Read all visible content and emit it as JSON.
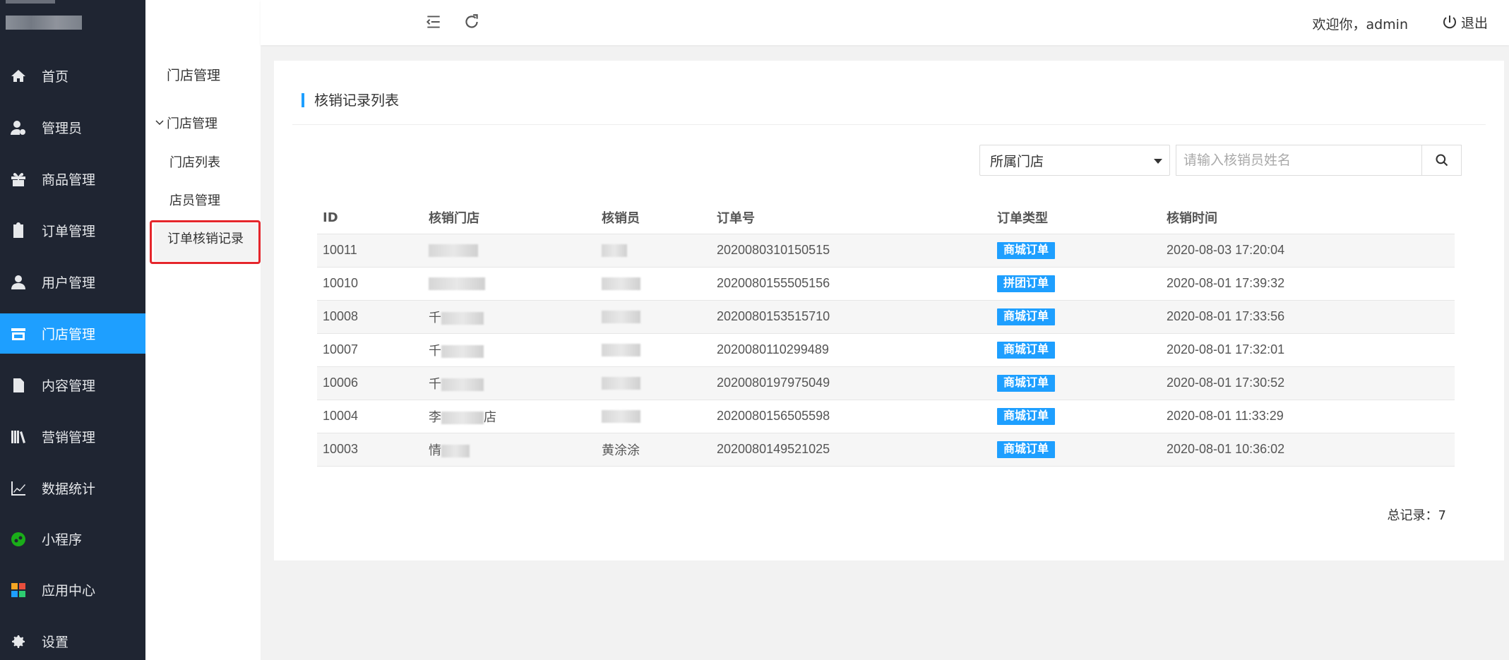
{
  "sidebar": {
    "items": [
      {
        "label": "首页",
        "icon": "home-icon"
      },
      {
        "label": "管理员",
        "icon": "admin-user-icon"
      },
      {
        "label": "商品管理",
        "icon": "gift-icon"
      },
      {
        "label": "订单管理",
        "icon": "clipboard-icon"
      },
      {
        "label": "用户管理",
        "icon": "user-icon"
      },
      {
        "label": "门店管理",
        "icon": "store-icon"
      },
      {
        "label": "内容管理",
        "icon": "document-icon"
      },
      {
        "label": "营销管理",
        "icon": "books-icon"
      },
      {
        "label": "数据统计",
        "icon": "line-chart-icon"
      },
      {
        "label": "小程序",
        "icon": "miniprogram-icon"
      },
      {
        "label": "应用中心",
        "icon": "apps-icon"
      },
      {
        "label": "设置",
        "icon": "gear-icon"
      }
    ],
    "active_index": 5
  },
  "subnav": {
    "title": "门店管理",
    "group": "门店管理",
    "links": [
      "门店列表",
      "店员管理",
      "订单核销记录"
    ],
    "active_link": "订单核销记录"
  },
  "header": {
    "welcome": "欢迎你，admin",
    "logout": "退出"
  },
  "card": {
    "title": "核销记录列表",
    "store_select": "所属门店",
    "search_placeholder": "请输入核销员姓名",
    "columns": [
      "ID",
      "核销门店",
      "核销员",
      "订单号",
      "订单类型",
      "核销时间"
    ],
    "rows": [
      {
        "id": "10011",
        "store": "",
        "staff": "",
        "order_no": "2020080310150515",
        "type": "商城订单",
        "time": "2020-08-03 17:20:04"
      },
      {
        "id": "10010",
        "store": "",
        "staff": "",
        "order_no": "2020080155505156",
        "type": "拼团订单",
        "time": "2020-08-01 17:39:32"
      },
      {
        "id": "10008",
        "store": "千",
        "staff": "",
        "order_no": "2020080153515710",
        "type": "商城订单",
        "time": "2020-08-01 17:33:56"
      },
      {
        "id": "10007",
        "store": "千",
        "staff": "",
        "order_no": "2020080110299489",
        "type": "商城订单",
        "time": "2020-08-01 17:32:01"
      },
      {
        "id": "10006",
        "store": "千",
        "staff": "",
        "order_no": "2020080197975049",
        "type": "商城订单",
        "time": "2020-08-01 17:30:52"
      },
      {
        "id": "10004",
        "store": "李",
        "store_suffix": "店",
        "staff": "",
        "order_no": "2020080156505598",
        "type": "商城订单",
        "time": "2020-08-01 11:33:29"
      },
      {
        "id": "10003",
        "store": "情",
        "staff": "黄涂涂",
        "order_no": "2020080149521025",
        "type": "商城订单",
        "time": "2020-08-01 10:36:02"
      }
    ],
    "total": "总记录：7"
  }
}
